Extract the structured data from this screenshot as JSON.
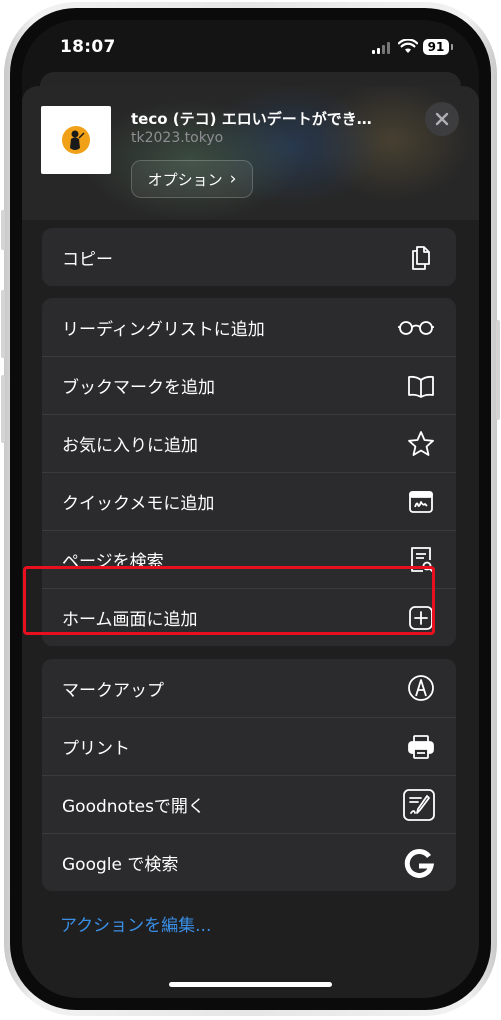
{
  "status_bar": {
    "time": "18:07",
    "battery": "91"
  },
  "share_header": {
    "title": "teco (テコ) エロいデートができ…",
    "url": "tk2023.tokyo",
    "options_label": "オプション",
    "options_chevron": "›"
  },
  "copy_group": [
    {
      "label": "コピー",
      "icon": "copy-icon"
    }
  ],
  "actions_group": [
    {
      "label": "リーディングリストに追加",
      "icon": "glasses-icon"
    },
    {
      "label": "ブックマークを追加",
      "icon": "book-icon"
    },
    {
      "label": "お気に入りに追加",
      "icon": "star-icon"
    },
    {
      "label": "クイックメモに追加",
      "icon": "quick-note-icon"
    },
    {
      "label": "ページを検索",
      "icon": "find-on-page-icon"
    },
    {
      "label": "ホーム画面に追加",
      "icon": "add-square-icon"
    }
  ],
  "extensions_group": [
    {
      "label": "マークアップ",
      "icon": "markup-icon"
    },
    {
      "label": "プリント",
      "icon": "printer-icon"
    },
    {
      "label": "Goodnotesで開く",
      "icon": "goodnotes-icon"
    },
    {
      "label": "Google で検索",
      "icon": "google-icon"
    }
  ],
  "edit_actions_label": "アクションを編集...",
  "colors": {
    "sheet_background": "#1f1f1f",
    "row_background": "#2b2b2d",
    "highlight_border": "#e8101f",
    "link_blue": "#3a8ee6"
  }
}
